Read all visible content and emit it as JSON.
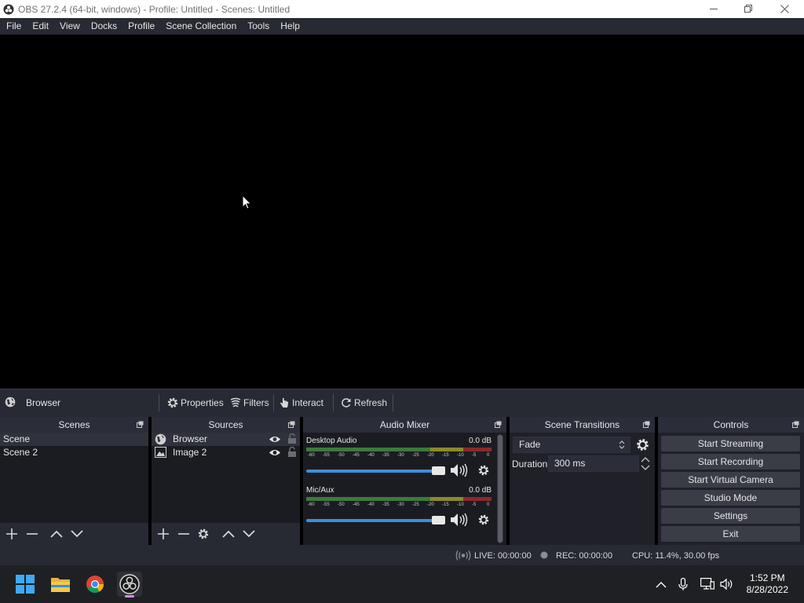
{
  "window": {
    "title": "OBS 27.2.4 (64-bit, windows) - Profile: Untitled - Scenes: Untitled"
  },
  "menu": {
    "items": [
      "File",
      "Edit",
      "View",
      "Docks",
      "Profile",
      "Scene Collection",
      "Tools",
      "Help"
    ]
  },
  "context_bar": {
    "source_name": "Browser",
    "properties_label": "Properties",
    "filters_label": "Filters",
    "interact_label": "Interact",
    "refresh_label": "Refresh"
  },
  "scenes": {
    "title": "Scenes",
    "items": [
      "Scene",
      "Scene 2"
    ],
    "selected": "Scene"
  },
  "sources": {
    "title": "Sources",
    "items": [
      {
        "name": "Browser",
        "icon": "globe-icon",
        "visible": true,
        "locked": false
      },
      {
        "name": "Image 2",
        "icon": "image-icon",
        "visible": true,
        "locked": false
      }
    ]
  },
  "audio_mixer": {
    "title": "Audio Mixer",
    "channels": [
      {
        "name": "Desktop Audio",
        "db": "0.0 dB",
        "volume": 1.0
      },
      {
        "name": "Mic/Aux",
        "db": "0.0 dB",
        "volume": 1.0
      }
    ],
    "ticks": [
      "-60",
      "-55",
      "-50",
      "-45",
      "-40",
      "-35",
      "-30",
      "-25",
      "-20",
      "-15",
      "-10",
      "-5",
      "0"
    ]
  },
  "transitions": {
    "title": "Scene Transitions",
    "selected": "Fade",
    "duration_label": "Duration",
    "duration_value": "300 ms"
  },
  "controls": {
    "title": "Controls",
    "buttons": [
      "Start Streaming",
      "Start Recording",
      "Start Virtual Camera",
      "Studio Mode",
      "Settings",
      "Exit"
    ]
  },
  "status": {
    "live": "LIVE: 00:00:00",
    "rec": "REC: 00:00:00",
    "cpu": "CPU: 11.4%, 30.00 fps"
  },
  "taskbar": {
    "apps": [
      "windows-start-icon",
      "file-explorer-icon",
      "chrome-icon",
      "obs-icon"
    ],
    "time": "1:52 PM",
    "date": "8/28/2022"
  },
  "colors": {
    "panel_bg": "#1f2028",
    "header_bg": "#2b2e38",
    "accent_blue": "#3d8fd8",
    "meter_green": "#3c7a3c",
    "meter_yellow": "#8a8a2a",
    "meter_red": "#8a2a2a"
  }
}
